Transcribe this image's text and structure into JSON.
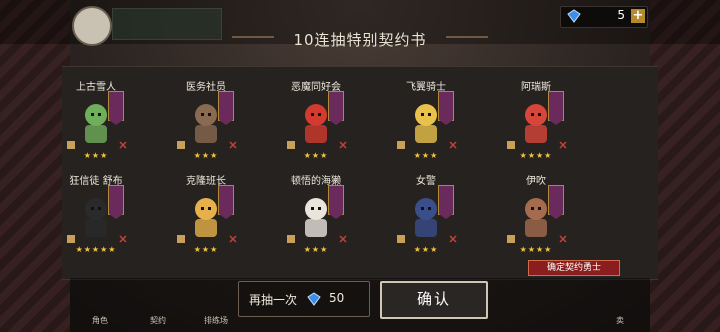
{
  "title": "10连抽特别契约书",
  "currency": {
    "icon": "gem-icon",
    "count": "5"
  },
  "cards": [
    {
      "name": "上古雪人",
      "stars": "★★★",
      "color": "#6fae5a"
    },
    {
      "name": "医务社员",
      "stars": "★★★",
      "color": "#8a6a50"
    },
    {
      "name": "恶魔同好会",
      "stars": "★★★",
      "color": "#d23b2e"
    },
    {
      "name": "飞翼骑士",
      "stars": "★★★",
      "color": "#e8c24a"
    },
    {
      "name": "阿瑞斯",
      "stars": "★★★★",
      "color": "#d8453a"
    },
    {
      "name": "狂信徒 舒布",
      "stars": "★★★★★",
      "color": "#2a2a2a"
    },
    {
      "name": "克隆班长",
      "stars": "★★★",
      "color": "#e6b14a"
    },
    {
      "name": "顿悟的海獭",
      "stars": "★★★",
      "color": "#e9e4dc"
    },
    {
      "name": "女警",
      "stars": "★★★",
      "color": "#3a4e8a"
    },
    {
      "name": "伊吹",
      "stars": "★★★★",
      "color": "#a56b4e"
    }
  ],
  "badge": "确定契约勇士",
  "draw_again": {
    "label": "再抽一次",
    "cost": "50"
  },
  "confirm": "确认",
  "nav": [
    "角色",
    "契约",
    "排练场",
    "",
    "",
    "",
    "",
    "",
    "卖"
  ],
  "colors": {
    "star": "#f2c43a",
    "banner": "#6a2b5c",
    "badge": "#8a1e1e"
  }
}
